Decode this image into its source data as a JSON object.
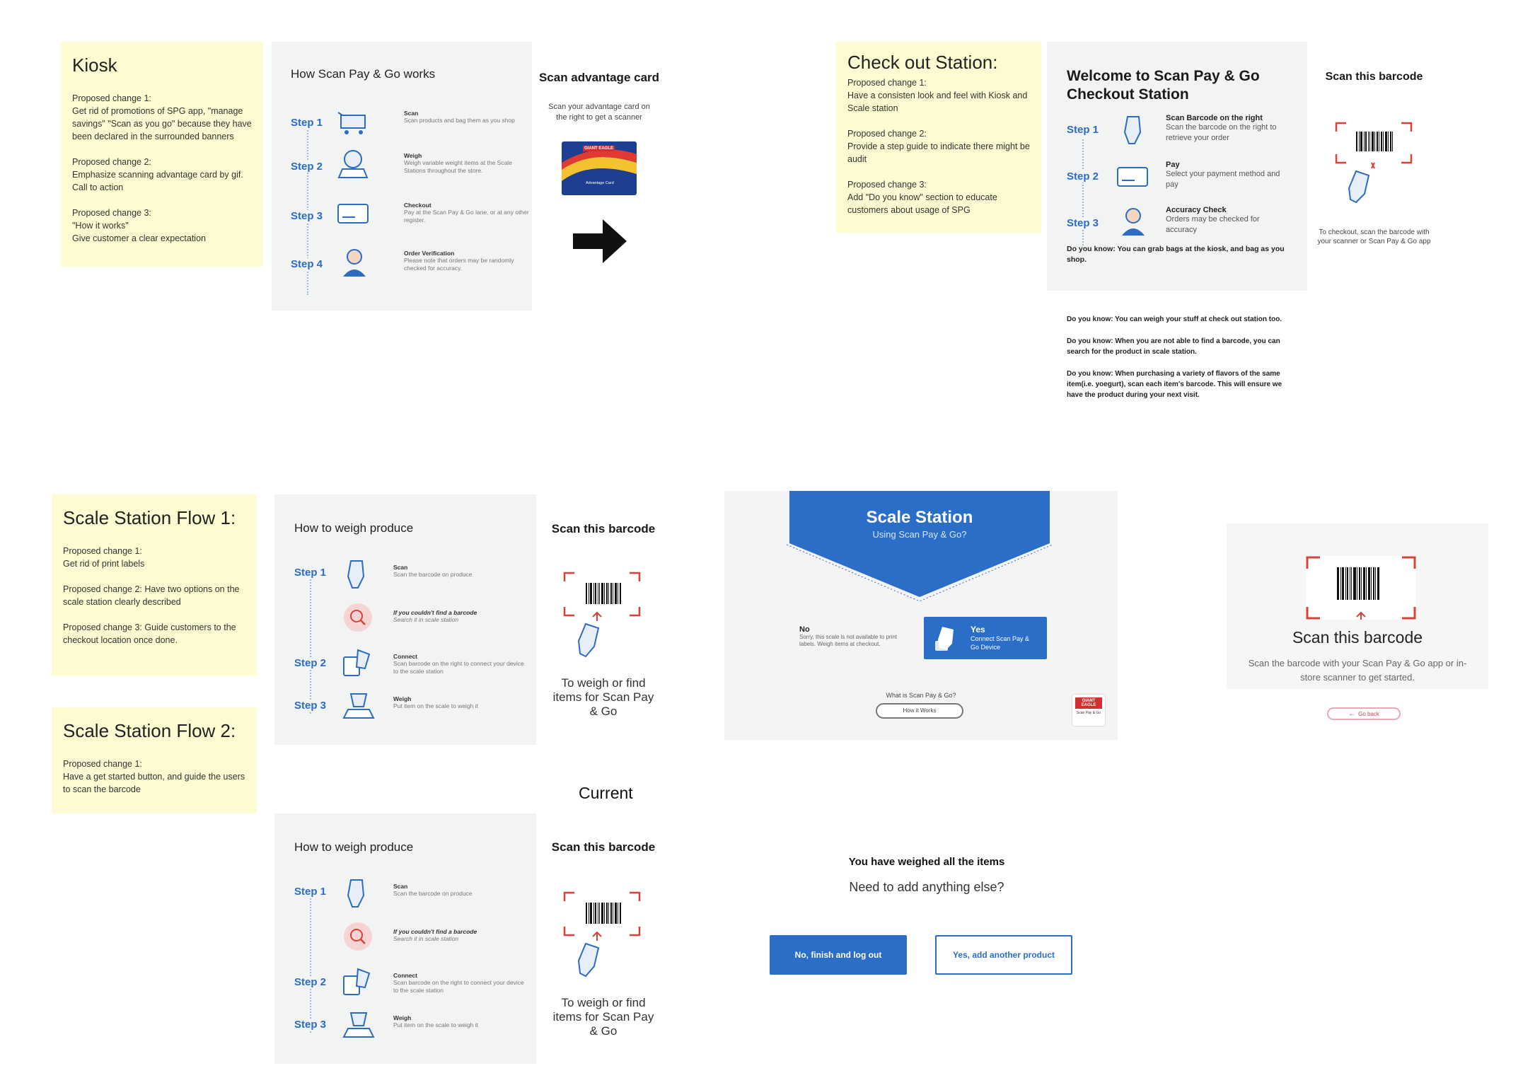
{
  "kiosk_note": {
    "title": "Kiosk",
    "p1": "Proposed change 1:\nGet rid of promotions of SPG app, \"manage savings\" \"Scan as you go\" because they have been declared in the surrounded banners",
    "p2": "Proposed change 2:\nEmphasize scanning advantage card by gif.\nCall to action",
    "p3": "Proposed change 3:\n\"How it works\"\nGive customer a clear expectation"
  },
  "kiosk_panel": {
    "title": "How Scan Pay & Go works",
    "steps": [
      {
        "label": "Step 1",
        "title": "Scan",
        "desc": "Scan products and bag them as you shop"
      },
      {
        "label": "Step 2",
        "title": "Weigh",
        "desc": "Weigh variable weight items at the Scale Stations throughout the store."
      },
      {
        "label": "Step 3",
        "title": "Checkout",
        "desc": "Pay at the Scan Pay & Go lane, or at any other register."
      },
      {
        "label": "Step 4",
        "title": "Order Verification",
        "desc": "Please note that orders may be randomly checked for accuracy."
      }
    ]
  },
  "advantage": {
    "title": "Scan advantage card",
    "desc": "Scan your advantage card on the right to get a scanner",
    "card_brand": "GIANT EAGLE",
    "card_label": "Advantage Card"
  },
  "checkout_note": {
    "title": "Check out Station:",
    "p1": "Proposed change 1:\nHave a consisten look and feel with Kiosk and Scale station",
    "p2": "Proposed change 2:\nProvide  a step guide to indicate there might be audit",
    "p3": "Proposed change 3:\nAdd \"Do you know\" section to educate customers about usage of SPG"
  },
  "checkout_panel": {
    "title": "Welcome to Scan Pay & Go Checkout Station",
    "steps": [
      {
        "label": "Step 1",
        "title": "Scan Barcode on the right",
        "desc": "Scan the barcode on the right to retrieve your order"
      },
      {
        "label": "Step 2",
        "title": "Pay",
        "desc": "Select your payment method and pay"
      },
      {
        "label": "Step 3",
        "title": "Accuracy Check",
        "desc": "Orders may be checked for accuracy"
      }
    ],
    "tip": "Do you know:  You can grab bags at the kiosk, and bag as you shop."
  },
  "checkout_barcode": {
    "title": "Scan this barcode",
    "caption": "To checkout, scan the barcode with your scanner or Scan Pay & Go app"
  },
  "tips": [
    "Do you know:  You can weigh your stuff at check out station too.",
    "Do you know: When you are not able to find a barcode, you can search for the product in scale station.",
    "Do you know: When purchasing a variety of flavors of the same item(i.e. yoegurt), scan each item's barcode. This will ensure we have the product during your next visit."
  ],
  "scale1_note": {
    "title": "Scale Station Flow 1:",
    "p1": "Proposed change 1:\nGet rid of print labels",
    "p2": "Proposed change 2: Have two options on the scale station clearly described",
    "p3": "Proposed change 3: Guide customers to the checkout location once done."
  },
  "scale2_note": {
    "title": "Scale Station Flow 2:",
    "p1": "Proposed change 1:\nHave a get started button, and guide the users to scan the barcode"
  },
  "weigh_panel": {
    "title": "How to weigh produce",
    "steps": [
      {
        "label": "Step 1",
        "title": "Scan",
        "desc": "Scan the barcode on produce"
      },
      {
        "label": "",
        "title": "If you couldn't find a barcode",
        "desc": "Search it in scale station"
      },
      {
        "label": "Step 2",
        "title": "Connect",
        "desc": "Scan barcode on the right to connect your device to the scale station"
      },
      {
        "label": "Step 3",
        "title": "Weigh",
        "desc": "Put item on the scale to weigh it"
      }
    ]
  },
  "weigh_barcode": {
    "title": "Scan this barcode",
    "caption": "To weigh or find items for Scan Pay & Go"
  },
  "current_label": "Current",
  "scale_station": {
    "title": "Scale Station",
    "subtitle": "Using Scan Pay & Go?",
    "no_title": "No",
    "no_desc": "Sorry, this scale is not available to print labels. Weigh items at checkout.",
    "yes_title": "Yes",
    "yes_desc": "Connect Scan Pay & Go Device",
    "question": "What is Scan Pay & Go?",
    "how_button": "How it Works",
    "logo_top": "GIANT EAGLE",
    "logo_bottom": "Scan Pay & Go"
  },
  "get_started": {
    "title": "Scan this barcode",
    "desc": "Scan the barcode with your Scan Pay & Go app or in-store scanner to get started.",
    "back": "Go back"
  },
  "done": {
    "title": "You have weighed all the items",
    "question": "Need to add anything else?",
    "finish": "No, finish and log out",
    "add": "Yes, add another product"
  },
  "colors": {
    "sticky": "#fdfbd2",
    "panel": "#f2f4f4",
    "accent": "#2b6cc4",
    "scan_corner": "#d9413a"
  }
}
